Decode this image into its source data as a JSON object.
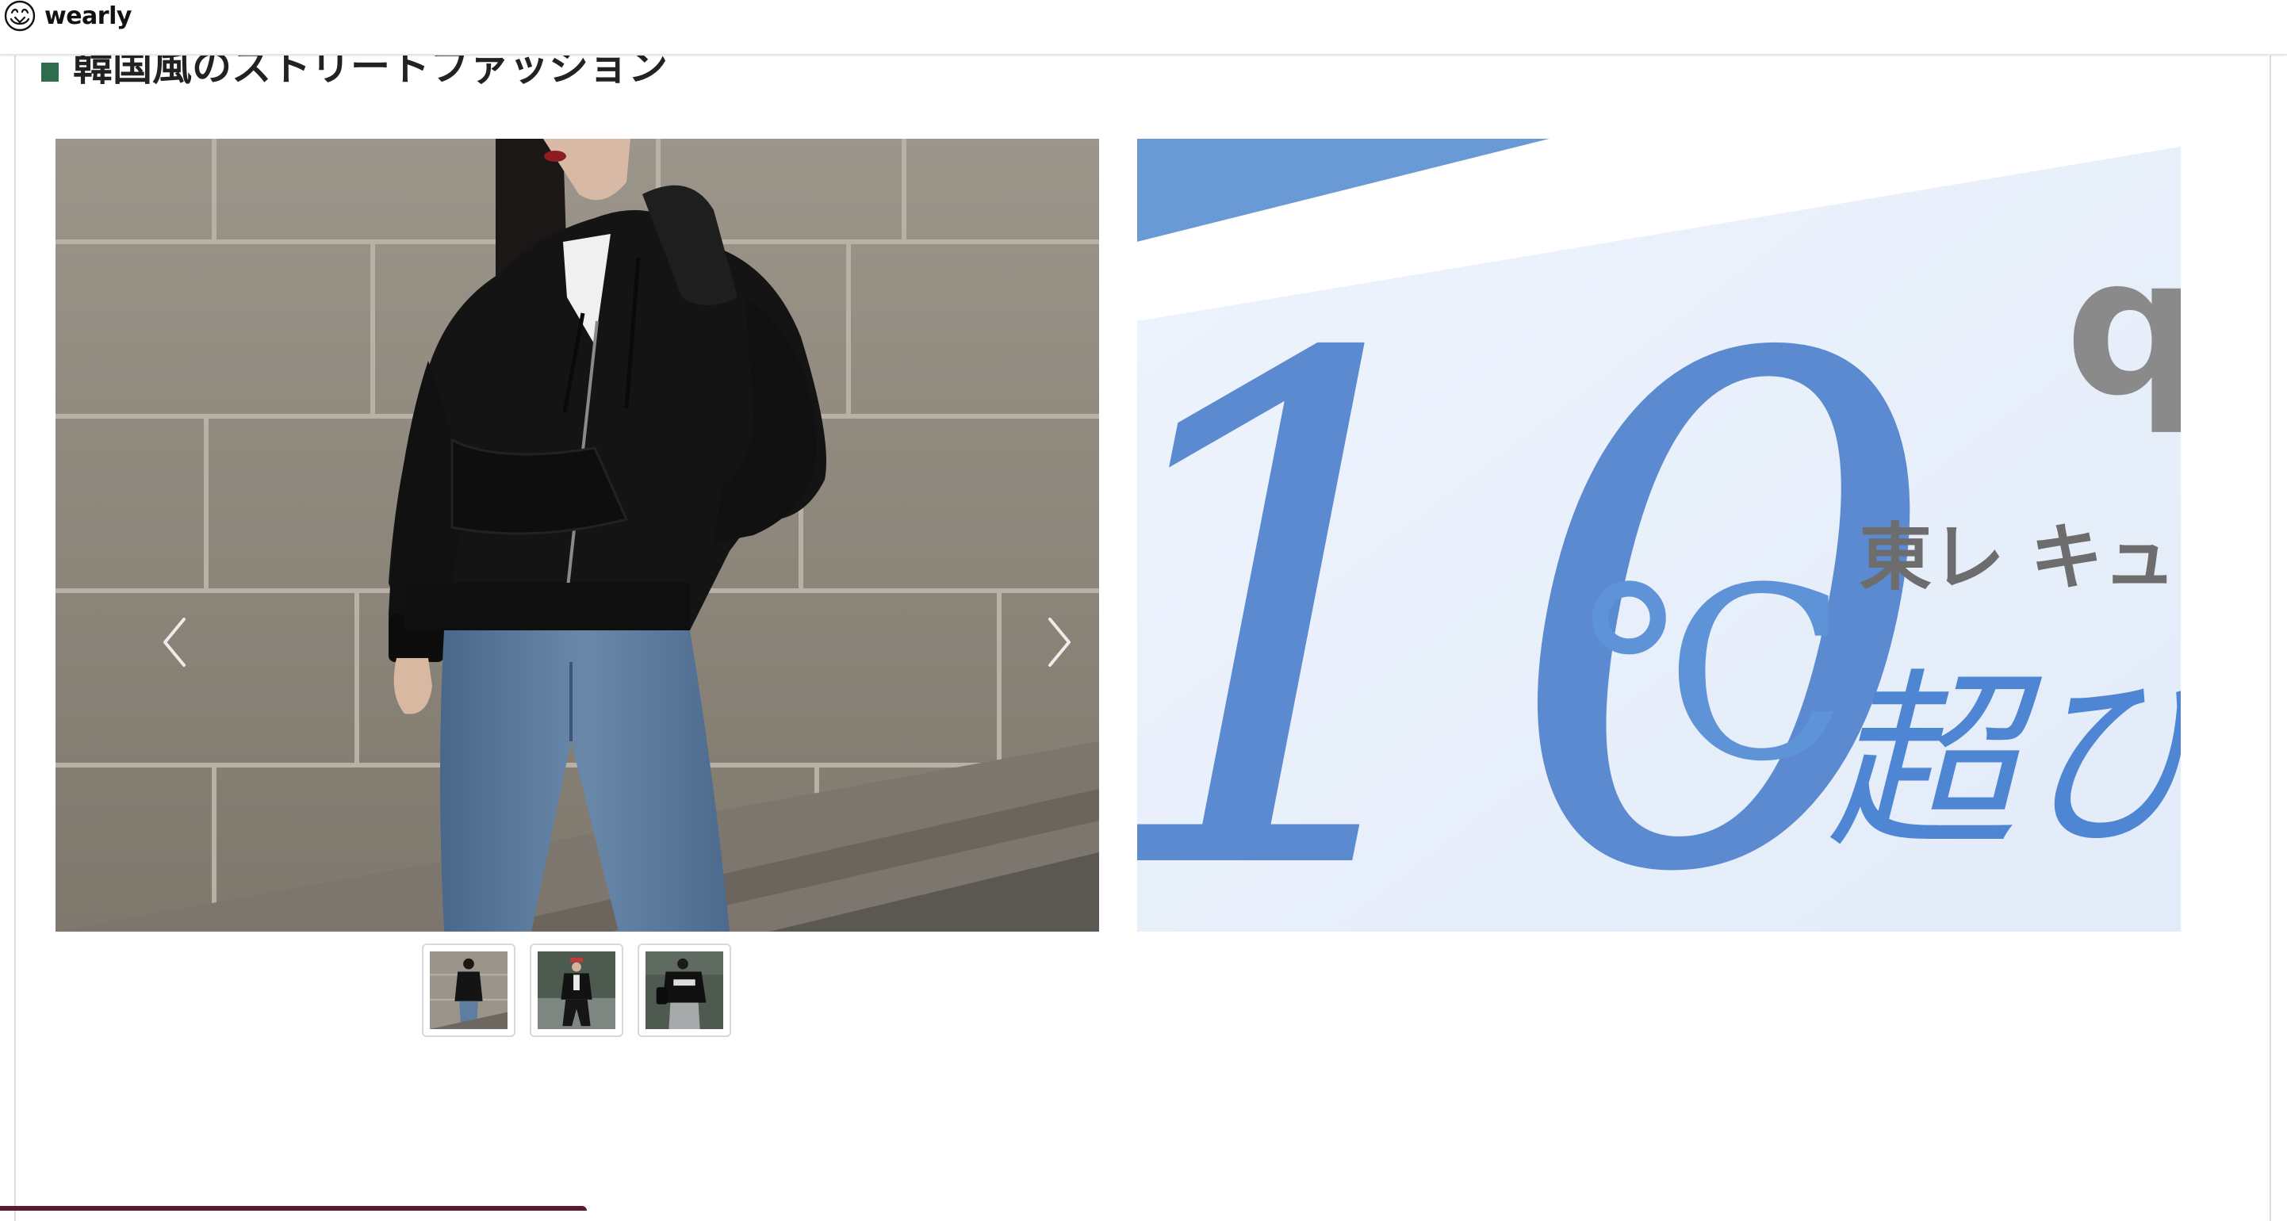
{
  "header": {
    "brand_name": "wearly",
    "logo_icon": "wearly-logo-icon"
  },
  "section": {
    "title": "韓国風のストリートファッション",
    "accent_color": "#2e6b4f"
  },
  "carousel": {
    "prev_icon": "chevron-left-icon",
    "next_icon": "chevron-right-icon",
    "main_image": "model-black-hoodie-jeans-photo"
  },
  "promo": {
    "big_number": "10",
    "unit": "℃",
    "brand_letter": "q",
    "small_text": "東レ キュ",
    "large_text": "超ひ",
    "color_blue": "#4f86d4"
  },
  "thumbnails": [
    {
      "name": "thumb-black-hoodie-jeans",
      "icon": "outfit-thumbnail"
    },
    {
      "name": "thumb-red-cap-black-jacket",
      "icon": "outfit-thumbnail"
    },
    {
      "name": "thumb-black-sweatshirt-gray-pants",
      "icon": "outfit-thumbnail"
    }
  ],
  "colors": {
    "header_border": "#e6e6e6",
    "bottom_strip": "#5a1a33"
  }
}
